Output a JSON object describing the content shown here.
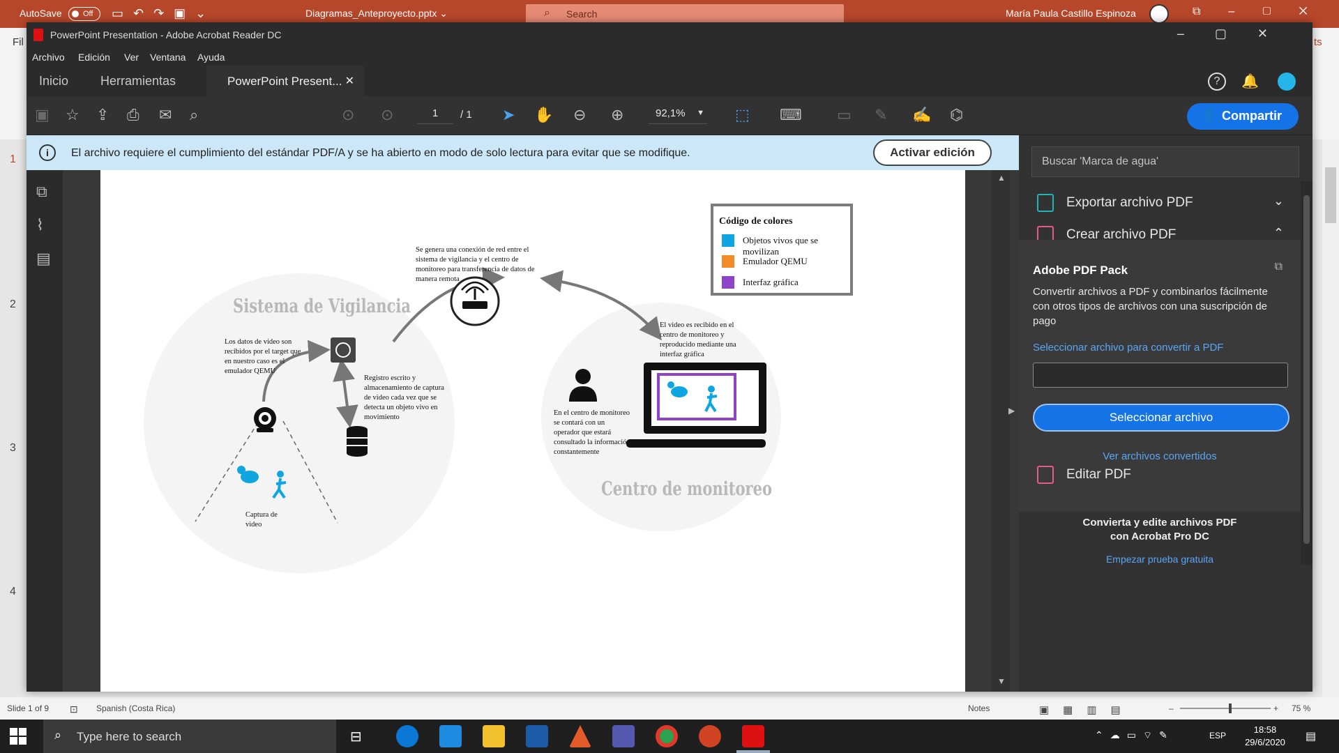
{
  "ppt": {
    "autosave_label": "AutoSave",
    "autosave_state": "Off",
    "filename": "Diagramas_Anteproyecto.pptx ⌄",
    "search_placeholder": "Search",
    "user_name": "María Paula Castillo Espinoza",
    "ribbon_left_char": "Fil",
    "ribbon_right_char": "ts",
    "slide_numbers": [
      "1",
      "2",
      "3",
      "4"
    ],
    "status": {
      "slide_info": "Slide 1 of 9",
      "language": "Spanish (Costa Rica)",
      "notes": "Notes",
      "zoom": "75 %"
    }
  },
  "acrobat": {
    "window_title": "PowerPoint Presentation - Adobe Acrobat Reader DC",
    "menu": [
      "Archivo",
      "Edición",
      "Ver",
      "Ventana",
      "Ayuda"
    ],
    "tabs": {
      "home": "Inicio",
      "tools": "Herramientas",
      "document": "PowerPoint Present..."
    },
    "toolbar": {
      "page_current": "1",
      "page_total": "/ 1",
      "zoom": "92,1%",
      "share_label": "Compartir"
    },
    "pdfa_notice": "El archivo requiere el cumplimiento del estándar PDF/A y se ha abierto en modo de solo lectura para evitar que se modifique.",
    "edit_button": "Activar edición",
    "right_panel": {
      "search_placeholder": "Buscar 'Marca de agua'",
      "export_pdf": "Exportar archivo PDF",
      "create_pdf": "Crear archivo PDF",
      "pack_title": "Adobe PDF Pack",
      "pack_desc": "Convertir archivos a PDF y combinarlos fácilmente con otros tipos de archivos con una suscripción de pago",
      "pack_select_link": "Seleccionar archivo para convertir a PDF",
      "pack_button": "Seleccionar archivo",
      "pack_view": "Ver archivos convertidos",
      "edit_pdf": "Editar PDF",
      "promo_line1": "Convierta y edite archivos PDF",
      "promo_line2": "con Acrobat Pro DC",
      "trial_link": "Empezar prueba gratuita"
    }
  },
  "diagram": {
    "title_left": "Sistema de Vigilancia",
    "title_right": "Centro de monitoreo",
    "note_network": "Se genera una conexión de red entre el sistema de vigilancia y el centro de monitoreo para transferencia de datos de manera remota",
    "note_data": "Los datos de video son recibidos por el target que en nuestro caso es el emulador QEMU",
    "note_storage": "Registro escrito y almacenamiento de captura de video cada vez que se detecta un objeto vivo en movimiento",
    "note_capture": "Captura de video",
    "note_video": "El video es recibido en el centro de monitoreo y reproducido mediante una interfaz gráfica",
    "note_operator": "En el centro de monitoreo se contará con un operador que estará consultado la información constantemente",
    "legend_title": "Código de colores",
    "legend": [
      {
        "label": "Objetos vivos que se movilizan",
        "color": "#0ea5e0"
      },
      {
        "label": "Emulador QEMU",
        "color": "#f28c28"
      },
      {
        "label": "Interfaz gráfica",
        "color": "#8e44c9"
      }
    ]
  },
  "taskbar": {
    "search_placeholder": "Type here to search",
    "lang": "ESP",
    "time": "18:58",
    "date": "29/6/2020"
  }
}
